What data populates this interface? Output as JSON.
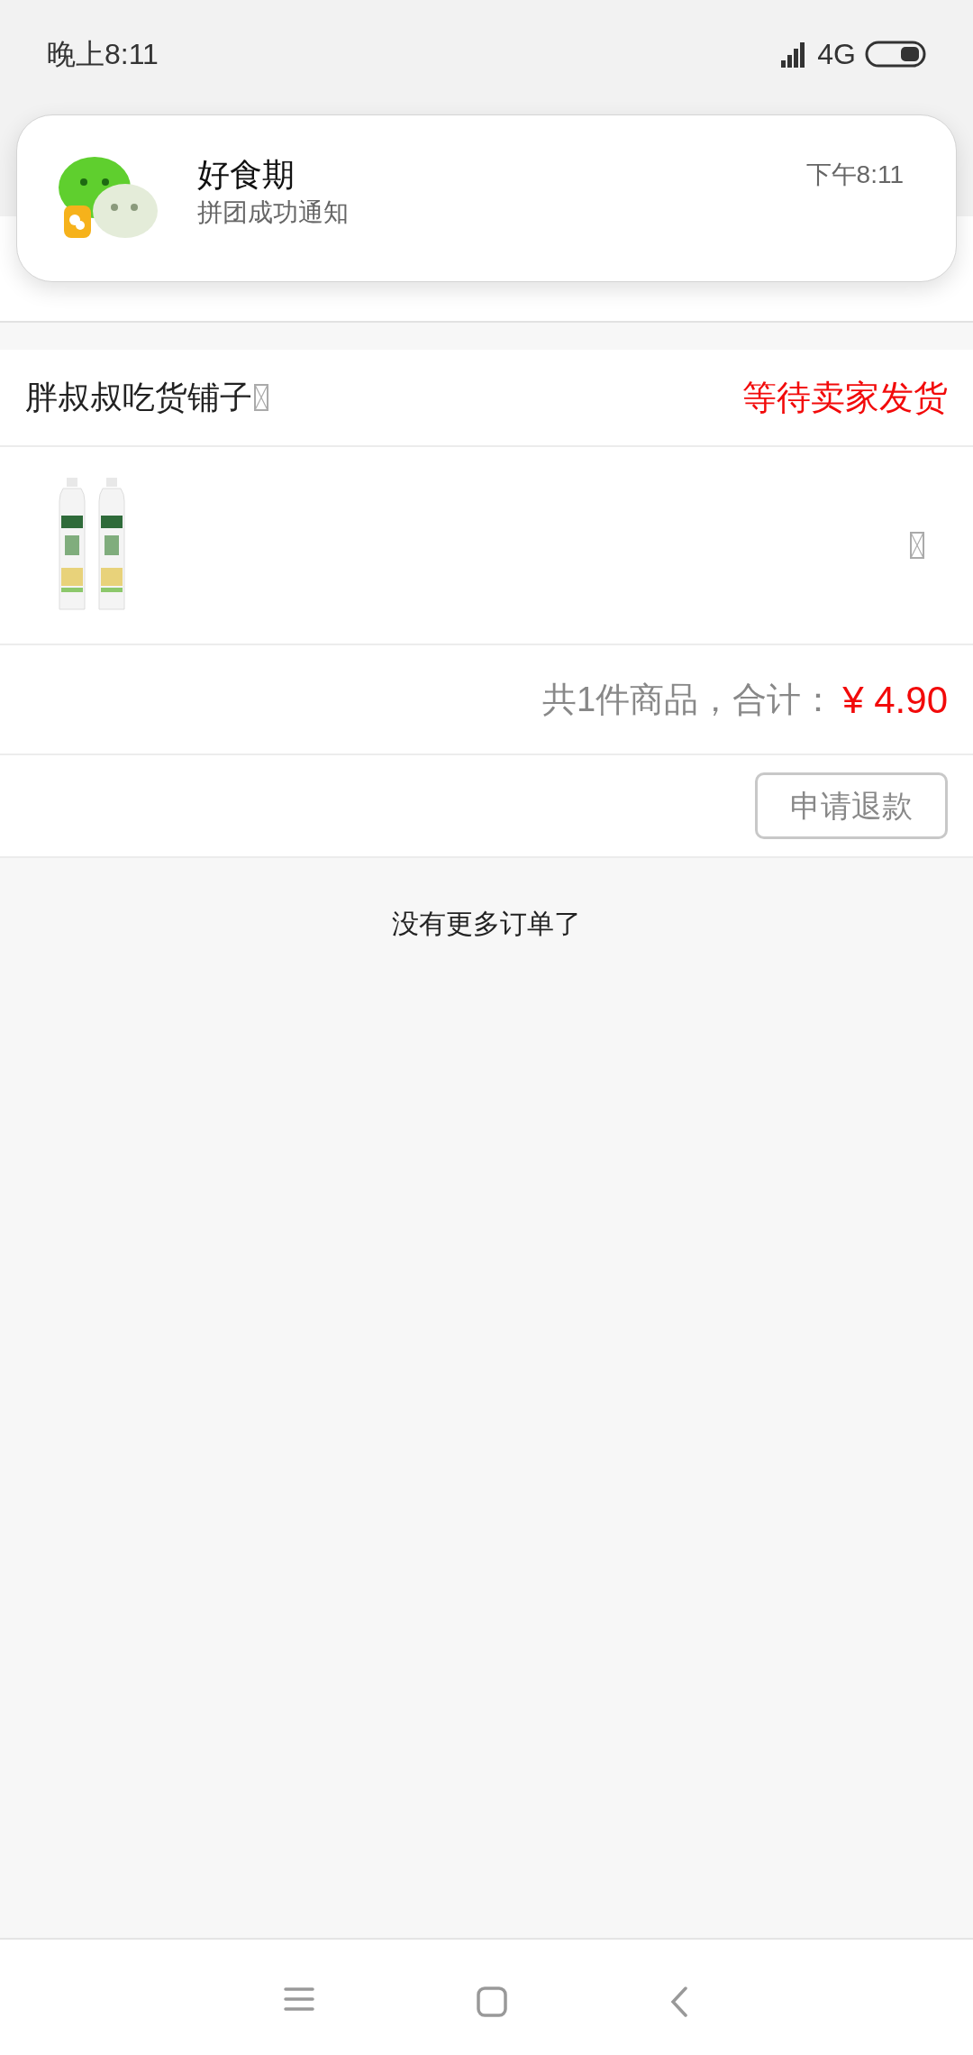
{
  "status_bar": {
    "time": "晚上8:11",
    "network": "4G"
  },
  "notification": {
    "app": "好食期",
    "message": "拼团成功通知",
    "time": "下午8:11"
  },
  "order": {
    "shop": "胖叔叔吃货铺子",
    "status": "等待卖家发货",
    "summary": "共1件商品，合计：",
    "total": "¥ 4.90",
    "actions": [
      "申请退款"
    ]
  },
  "footer": "没有更多订单了"
}
